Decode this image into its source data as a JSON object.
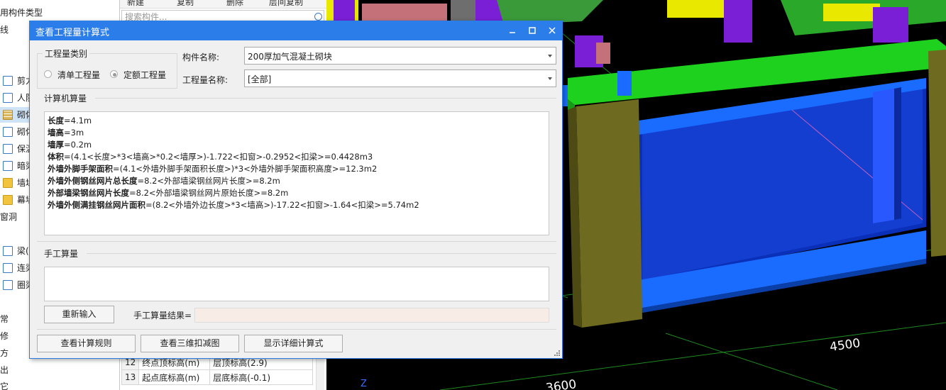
{
  "left_panel": {
    "header": "用构件类型",
    "items": [
      {
        "label": "线",
        "icon": ""
      },
      {
        "label": "剪力",
        "icon": "shear-wall-icon"
      },
      {
        "label": "人防",
        "icon": "civil-defense-icon"
      },
      {
        "label": "砌体",
        "icon": "brick-wall-icon",
        "selected": true
      },
      {
        "label": "砌体",
        "icon": "brick-reinforcement-icon"
      },
      {
        "label": "保温",
        "icon": "insulation-icon"
      },
      {
        "label": "暗梁",
        "icon": "hidden-beam-icon"
      },
      {
        "label": "墙垛",
        "icon": "wall-pier-icon"
      },
      {
        "label": "幕墙",
        "icon": "curtain-wall-icon"
      },
      {
        "label": "窗洞",
        "icon": ""
      },
      {
        "label": "梁(",
        "icon": "beam-icon"
      },
      {
        "label": "连梁",
        "icon": "link-beam-icon"
      },
      {
        "label": "圈梁",
        "icon": "ring-beam-icon"
      },
      {
        "label": "常",
        "icon": ""
      },
      {
        "label": "修",
        "icon": ""
      },
      {
        "label": "方",
        "icon": ""
      },
      {
        "label": "出",
        "icon": ""
      },
      {
        "label": "它",
        "icon": ""
      }
    ]
  },
  "mid_panel": {
    "toolbar": {
      "new": "新建",
      "copy": "复制",
      "delete": "删除",
      "floor_copy": "层间复制"
    },
    "search_placeholder": "搜索构件...",
    "rows": [
      {
        "num": "12",
        "name": "终点顶标高(m)",
        "value": "层顶标高(2.9)"
      },
      {
        "num": "13",
        "name": "起点底标高(m)",
        "value": "层底标高(-0.1)"
      }
    ]
  },
  "viewport": {
    "dimension_label_1": "4500",
    "dimension_label_2": "3600",
    "axis_label": "Z"
  },
  "dialog": {
    "title": "查看工程量计算式",
    "type_group": {
      "label": "工程量类别",
      "option_bill": "清单工程量",
      "option_quota": "定额工程量",
      "selected": "quota"
    },
    "component_name_label": "构件名称:",
    "component_name_value": "200厚加气混凝土砌块",
    "quantity_name_label": "工程量名称:",
    "quantity_name_value": "[全部]",
    "computer_section_label": "计算机算量",
    "formulas": [
      {
        "key": "长度",
        "expr": "=4.1m"
      },
      {
        "key": "墙高",
        "expr": "=3m"
      },
      {
        "key": "墙厚",
        "expr": "=0.2m"
      },
      {
        "key": "体积",
        "expr": "=(4.1<长度>*3<墙高>*0.2<墙厚>)-1.722<扣窗>-0.2952<扣梁>=0.4428m3"
      },
      {
        "key": "外墙外脚手架面积",
        "expr": "=(4.1<外墙外脚手架面积长度>)*3<外墙外脚手架面积高度>=12.3m2"
      },
      {
        "key": "外墙外侧钢丝网片总长度",
        "expr": "=8.2<外部墙梁钢丝网片长度>=8.2m"
      },
      {
        "key": "外部墙梁钢丝网片长度",
        "expr": "=8.2<外部墙梁钢丝网片原始长度>=8.2m"
      },
      {
        "key": "外墙外侧满挂钢丝网片面积",
        "expr": "=(8.2<外墙外边长度>*3<墙高>)-17.22<扣窗>-1.64<扣梁>=5.74m2"
      }
    ],
    "manual_section_label": "手工算量",
    "reenter_button": "重新输入",
    "manual_result_label": "手工算量结果=",
    "manual_result_value": "",
    "buttons": {
      "view_rules": "查看计算规则",
      "view_3d": "查看三维扣减图",
      "show_detail": "显示详细计算式"
    }
  }
}
